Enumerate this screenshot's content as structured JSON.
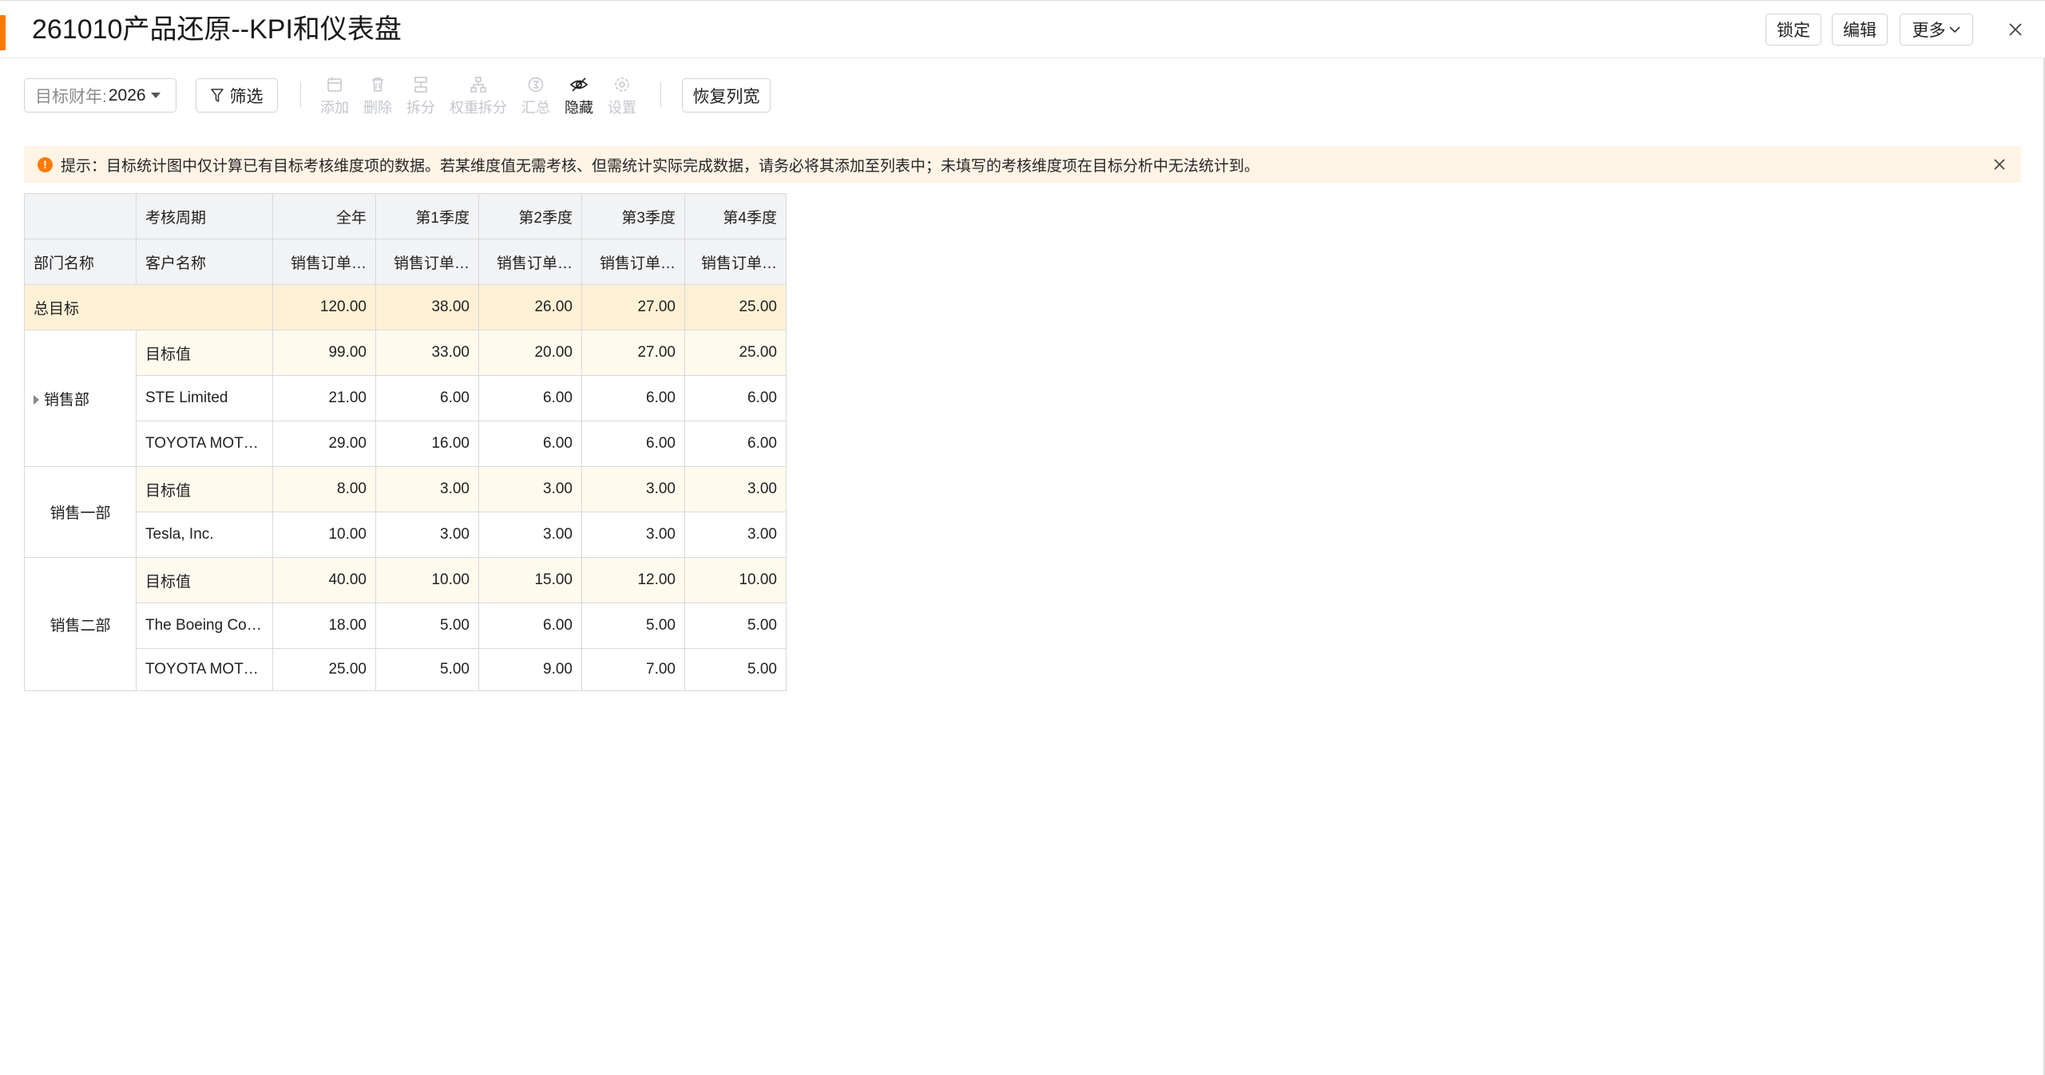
{
  "header": {
    "title": "261010产品还原--KPI和仪表盘",
    "lock_label": "锁定",
    "edit_label": "编辑",
    "more_label": "更多",
    "close_icon": "close-icon"
  },
  "toolbar": {
    "year_label": "目标财年:",
    "year_value": "2026",
    "filter_label": "筛选",
    "tools": {
      "add": "添加",
      "delete": "删除",
      "split": "拆分",
      "weight_split": "权重拆分",
      "summary": "汇总",
      "hide": "隐藏",
      "settings": "设置"
    },
    "restore_label": "恢复列宽"
  },
  "notice": {
    "text": "提示：目标统计图中仅计算已有目标考核维度项的数据。若某维度值无需考核、但需统计实际完成数据，请务必将其添加至列表中；未填写的考核维度项在目标分析中无法统计到。"
  },
  "colors": {
    "accent": "#ff7a00",
    "notice_bg": "#fff4e6",
    "total_row_bg": "#fff1d6",
    "target_row_bg": "#fffaee",
    "header_bg": "#f2f3f5"
  },
  "table": {
    "period_header": "考核周期",
    "dept_header": "部门名称",
    "customer_header": "客户名称",
    "columns": [
      "全年",
      "第1季度",
      "第2季度",
      "第3季度",
      "第4季度"
    ],
    "metric": [
      "销售订单…",
      "销售订单…",
      "销售订单…",
      "销售订单…",
      "销售订单…"
    ],
    "total_label": "总目标",
    "total_values": [
      "120.00",
      "38.00",
      "26.00",
      "27.00",
      "25.00"
    ],
    "groups": [
      {
        "dept": "销售部",
        "rows": [
          {
            "name": "目标值",
            "values": [
              "99.00",
              "33.00",
              "20.00",
              "27.00",
              "25.00"
            ]
          },
          {
            "name": "STE Limited",
            "values": [
              "21.00",
              "6.00",
              "6.00",
              "6.00",
              "6.00"
            ]
          },
          {
            "name": "TOYOTA MOT…",
            "values": [
              "29.00",
              "16.00",
              "6.00",
              "6.00",
              "6.00"
            ]
          }
        ]
      },
      {
        "dept": "销售一部",
        "rows": [
          {
            "name": "目标值",
            "values": [
              "8.00",
              "3.00",
              "3.00",
              "3.00",
              "3.00"
            ]
          },
          {
            "name": "Tesla, Inc.",
            "values": [
              "10.00",
              "3.00",
              "3.00",
              "3.00",
              "3.00"
            ]
          }
        ]
      },
      {
        "dept": "销售二部",
        "rows": [
          {
            "name": "目标值",
            "values": [
              "40.00",
              "10.00",
              "15.00",
              "12.00",
              "10.00"
            ]
          },
          {
            "name": "The Boeing Co…",
            "values": [
              "18.00",
              "5.00",
              "6.00",
              "5.00",
              "5.00"
            ]
          },
          {
            "name": "TOYOTA MOT…",
            "values": [
              "25.00",
              "5.00",
              "9.00",
              "7.00",
              "5.00"
            ]
          }
        ]
      }
    ]
  }
}
